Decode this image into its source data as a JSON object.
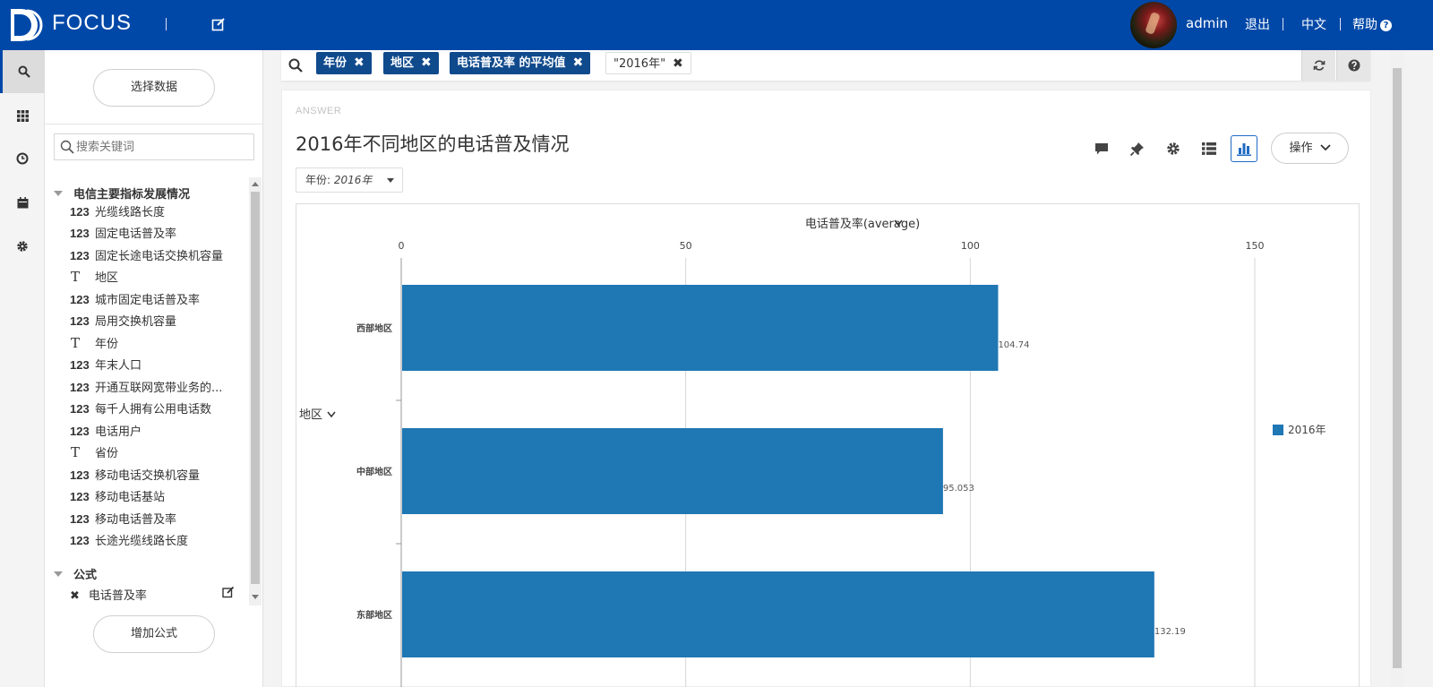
{
  "app": {
    "brand": "FOCUS",
    "user": "admin",
    "logout": "退出",
    "language": "中文",
    "help": "帮助"
  },
  "left_panel": {
    "select_data_label": "选择数据",
    "search_placeholder": "搜索关键词",
    "group_main": "电信主要指标发展情况",
    "fields": [
      {
        "type": "123",
        "label": "光缆线路长度"
      },
      {
        "type": "123",
        "label": "固定电话普及率"
      },
      {
        "type": "123",
        "label": "固定长途电话交换机容量"
      },
      {
        "type": "T",
        "label": "地区"
      },
      {
        "type": "123",
        "label": "城市固定电话普及率"
      },
      {
        "type": "123",
        "label": "局用交换机容量"
      },
      {
        "type": "T",
        "label": "年份"
      },
      {
        "type": "123",
        "label": "年末人口"
      },
      {
        "type": "123",
        "label": "开通互联网宽带业务的..."
      },
      {
        "type": "123",
        "label": "每千人拥有公用电话数"
      },
      {
        "type": "123",
        "label": "电话用户"
      },
      {
        "type": "T",
        "label": "省份"
      },
      {
        "type": "123",
        "label": "移动电话交换机容量"
      },
      {
        "type": "123",
        "label": "移动电话基站"
      },
      {
        "type": "123",
        "label": "移动电话普及率"
      },
      {
        "type": "123",
        "label": "长途光缆线路长度"
      }
    ],
    "group_formula": "公式",
    "formula_item": "电话普及率",
    "add_formula_label": "增加公式"
  },
  "search_bar": {
    "chips": [
      "年份",
      "地区",
      "电话普及率 的平均值"
    ],
    "literal_chip": "\"2016年\""
  },
  "answer": {
    "tag": "ANSWER",
    "title": "2016年不同地区的电话普及情况",
    "filter_label": "年份: ",
    "filter_value": "2016年",
    "ops_label": "操作"
  },
  "chart_data": {
    "type": "bar",
    "orientation": "horizontal",
    "categories": [
      "西部地区",
      "中部地区",
      "东部地区"
    ],
    "values": [
      104.74,
      95.053,
      132.19
    ],
    "value_labels": [
      "104.74",
      "95.053",
      "132.19"
    ],
    "xlabel": "电话普及率(average)",
    "ylabel": "地区",
    "xlim": [
      0,
      150
    ],
    "xticks": [
      "0",
      "50",
      "100",
      "150"
    ],
    "series": [
      {
        "name": "2016年",
        "color": "#1f77b4"
      }
    ],
    "grid": true,
    "legend": "right"
  }
}
